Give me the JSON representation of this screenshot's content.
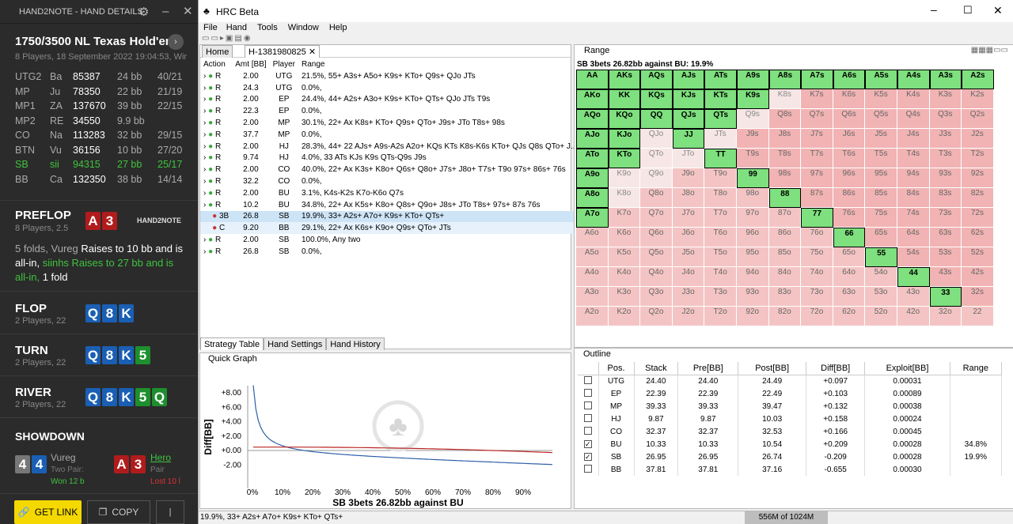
{
  "h2n": {
    "title": "HAND2NOTE - HAND DETAILS",
    "game": "1750/3500 NL Texas Hold'em",
    "info": "8 Players, 18 September 2022 19:04:53, Wir",
    "players": [
      {
        "pos": "UTG2",
        "name": "Ba",
        "stack": "85387",
        "bb": "24 bb",
        "stat": "40/21"
      },
      {
        "pos": "MP",
        "name": "Ju",
        "stack": "78350",
        "bb": "22 bb",
        "stat": "21/19"
      },
      {
        "pos": "MP1",
        "name": "ZA",
        "stack": "137670",
        "bb": "39 bb",
        "stat": "22/15"
      },
      {
        "pos": "MP2",
        "name": "RE",
        "stack": "34550",
        "bb": "9.9 bb",
        "stat": ""
      },
      {
        "pos": "CO",
        "name": "Na",
        "stack": "113283",
        "bb": "32 bb",
        "stat": "29/15"
      },
      {
        "pos": "BTN",
        "name": "Vu",
        "stack": "36156",
        "bb": "10 bb",
        "stat": "27/20"
      },
      {
        "pos": "SB",
        "name": "sii",
        "stack": "94315",
        "bb": "27 bb",
        "stat": "25/17"
      },
      {
        "pos": "BB",
        "name": "Ca",
        "stack": "132350",
        "bb": "38 bb",
        "stat": "14/14"
      }
    ],
    "preflop": {
      "label": "PREFLOP",
      "sub": "8 Players, 2.5",
      "logo": "HAND2NOTE",
      "t1": "5 folds, Vureg ",
      "t2": "Raises to 10 bb and is all-in, ",
      "t3": "siinhs Raises to 27 bb and is all-in, ",
      "t4": "1 fold"
    },
    "flop": {
      "label": "FLOP",
      "sub": "2 Players, 22"
    },
    "turn": {
      "label": "TURN",
      "sub": "2 Players, 22"
    },
    "river": {
      "label": "RIVER",
      "sub": "2 Players, 22"
    },
    "showdown": {
      "label": "SHOWDOWN",
      "p1": "Vureg",
      "p1h": "Two Pair:",
      "p1r": "Won 12 b",
      "p2": "Hero",
      "p2h": "Pair",
      "p2r": "Lost 10 l"
    },
    "getlink": "GET LINK",
    "copy": "COPY"
  },
  "hrc": {
    "title": "HRC Beta",
    "menu": [
      "File",
      "Hand",
      "Tools",
      "Window",
      "Help"
    ],
    "tabs": [
      "Home",
      "H-1381980825"
    ],
    "act_headers": [
      "Action",
      "Amt [BB]",
      "Player",
      "Range"
    ],
    "actions": [
      [
        "R",
        "2.00",
        "UTG",
        "21.5%, 55+ A3s+ A5o+ K9s+ KTo+ Q9s+ QJo JTs"
      ],
      [
        "R",
        "24.3",
        "UTG",
        "0.0%,"
      ],
      [
        "R",
        "2.00",
        "EP",
        "24.4%, 44+ A2s+ A3o+ K9s+ KTo+ QTs+ QJo JTs T9s"
      ],
      [
        "R",
        "22.3",
        "EP",
        "0.0%,"
      ],
      [
        "R",
        "2.00",
        "MP",
        "30.1%, 22+ Ax K8s+ KTo+ Q9s+ QTo+ J9s+ JTo T8s+ 98s"
      ],
      [
        "R",
        "37.7",
        "MP",
        "0.0%,"
      ],
      [
        "R",
        "2.00",
        "HJ",
        "28.3%, 44+ 22 AJs+ A9s-A2s A2o+ KQs KTs K8s-K6s KTo+ QJs Q8s QTo+ J..."
      ],
      [
        "R",
        "9.74",
        "HJ",
        "4.0%, 33 ATs KJs K9s QTs-Q9s J9s"
      ],
      [
        "R",
        "2.00",
        "CO",
        "40.0%, 22+ Ax K3s+ K8o+ Q6s+ Q8o+ J7s+ J8o+ T7s+ T9o 97s+ 86s+ 76s"
      ],
      [
        "R",
        "32.2",
        "CO",
        "0.0%,"
      ],
      [
        "R",
        "2.00",
        "BU",
        "3.1%, K4s-K2s K7o-K6o Q7s"
      ],
      [
        "R",
        "10.2",
        "BU",
        "34.8%, 22+ Ax K5s+ K8o+ Q8s+ Q9o+ J8s+ JTo T8s+ 97s+ 87s 76s"
      ],
      [
        "3B",
        "26.8",
        "SB",
        "19.9%, 33+ A2s+ A7o+ K9s+ KTo+ QTs+"
      ],
      [
        "C",
        "9.20",
        "BB",
        "29.1%, 22+ Ax K6s+ K9o+ Q9s+ QTo+ JTs"
      ],
      [
        "R",
        "2.00",
        "SB",
        "100.0%, Any two"
      ],
      [
        "R",
        "26.8",
        "SB",
        "0.0%,"
      ]
    ],
    "bottom_tabs": [
      "Strategy Table",
      "Hand Settings",
      "Hand History"
    ],
    "range_title": "Range",
    "range_desc": "SB 3bets 26.82bb against BU: 19.9%",
    "quick_graph": "Quick Graph",
    "graph_title": "SB 3bets 26.82bb against BU",
    "graph_ylabel": "Diff[BB]",
    "yticks": [
      "+8.00",
      "+6.00",
      "+4.00",
      "+2.00",
      "+0.00",
      "-2.00"
    ],
    "xticks": [
      "0%",
      "10%",
      "20%",
      "30%",
      "40%",
      "50%",
      "60%",
      "70%",
      "80%",
      "90%"
    ],
    "outline": "Outline",
    "out_headers": [
      "Pos.",
      "Stack",
      "Pre[BB]",
      "Post[BB]",
      "Diff[BB]",
      "Exploit[BB]",
      "Range"
    ],
    "out_rows": [
      [
        "UTG",
        "24.40",
        "24.40",
        "24.49",
        "+0.097",
        "0.00031",
        "",
        false
      ],
      [
        "EP",
        "22.39",
        "22.39",
        "22.49",
        "+0.103",
        "0.00089",
        "",
        false
      ],
      [
        "MP",
        "39.33",
        "39.33",
        "39.47",
        "+0.132",
        "0.00038",
        "",
        false
      ],
      [
        "HJ",
        "9.87",
        "9.87",
        "10.03",
        "+0.158",
        "0.00024",
        "",
        false
      ],
      [
        "CO",
        "32.37",
        "32.37",
        "32.53",
        "+0.166",
        "0.00045",
        "",
        false
      ],
      [
        "BU",
        "10.33",
        "10.33",
        "10.54",
        "+0.209",
        "0.00028",
        "34.8%",
        true
      ],
      [
        "SB",
        "26.95",
        "26.95",
        "26.74",
        "-0.209",
        "0.00028",
        "19.9%",
        true
      ],
      [
        "BB",
        "37.81",
        "37.81",
        "37.16",
        "-0.655",
        "0.00030",
        "",
        false
      ]
    ],
    "status": "19.9%, 33+ A2s+ A7o+ K9s+ KTo+ QTs+",
    "memory": "556M of 1024M"
  }
}
